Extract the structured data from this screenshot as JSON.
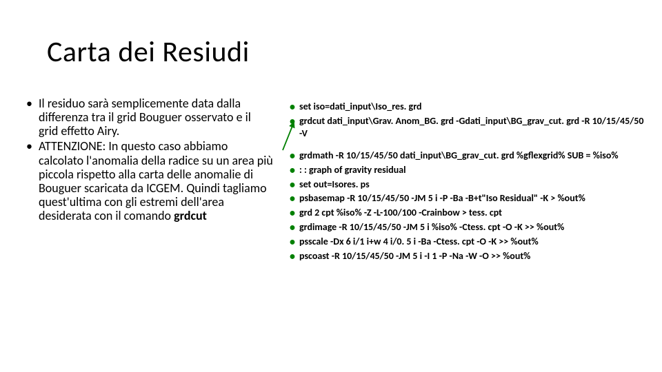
{
  "title": "Carta dei Resiudi",
  "left": {
    "p1_a": "Il residuo sarà semplicemente data dalla differenza tra il grid Bouguer osservato e il grid effetto Airy.",
    "p2_a": "ATTENZIONE: In questo caso abbiamo calcolato l'anomalia della radice su un area più piccola rispetto alla carta delle anomalie di Bouguer scaricata da ICGEM. Quindi tagliamo quest'ultima con gli estremi dell'area desiderata con il comando ",
    "p2_b": "grdcut"
  },
  "right": {
    "l1_a": "set iso=dati_input\\Iso_res. grd",
    "l2_a": "grdcut ",
    "l2_b": "dati_input\\Grav. Anom_BG. grd -Gdati_input\\BG_grav_cut. grd -R 10/15/45/50 -V",
    "l3_a": "grdmath ",
    "l3_b": "-R 10/15/45/50 dati_input\\BG_grav_cut. grd %gflexgrid% SUB = %iso%",
    "l4_a": ": : graph of gravity residual",
    "l5_a": "set out=Isores. ps",
    "l6_a": "psbasemap ",
    "l6_b": " -R 10/15/45/50 -JM 5 i -P -Ba -B+t\"Iso Residual\"  -K > %out%",
    "l7_a": "grd 2 cpt ",
    "l7_b": "%iso% -Z -L-100/100 -Crainbow   > tess. cpt",
    "l8_a": "grdimage ",
    "l8_b": " -R 10/15/45/50 -JM 5 i %iso% -Ctess. cpt  -O -K >> %out%",
    "l9_a": "psscale ",
    "l9_b": "-Dx 6 i/1 i+w 4 i/0. 5 i -Ba -Ctess. cpt  -O -K >> %out%",
    "l10_a": "pscoast ",
    "l10_b": "-R 10/15/45/50 -JM 5 i -I 1 -P -Na -W  -O  >> %out%"
  }
}
